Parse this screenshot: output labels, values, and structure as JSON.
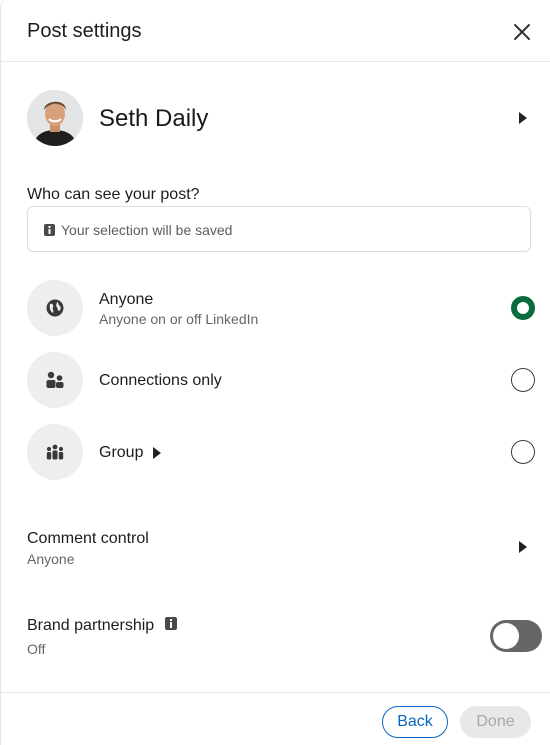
{
  "header": {
    "title": "Post settings"
  },
  "profile": {
    "name": "Seth Daily"
  },
  "visibility": {
    "label": "Who can see your post?",
    "notice": "Your selection will be saved",
    "options": [
      {
        "title": "Anyone",
        "subtitle": "Anyone on or off LinkedIn",
        "icon": "globe-icon",
        "selected": true
      },
      {
        "title": "Connections only",
        "subtitle": "",
        "icon": "people-icon",
        "selected": false
      },
      {
        "title": "Group",
        "subtitle": "",
        "icon": "group-icon",
        "selected": false
      }
    ]
  },
  "comment_control": {
    "title": "Comment control",
    "value": "Anyone"
  },
  "brand_partnership": {
    "title": "Brand partnership",
    "value": "Off",
    "enabled": false
  },
  "footer": {
    "back_label": "Back",
    "done_label": "Done"
  },
  "colors": {
    "accent": "#0a66c2",
    "selected_radio": "#0a6b3f",
    "toggle_off": "#666666"
  }
}
